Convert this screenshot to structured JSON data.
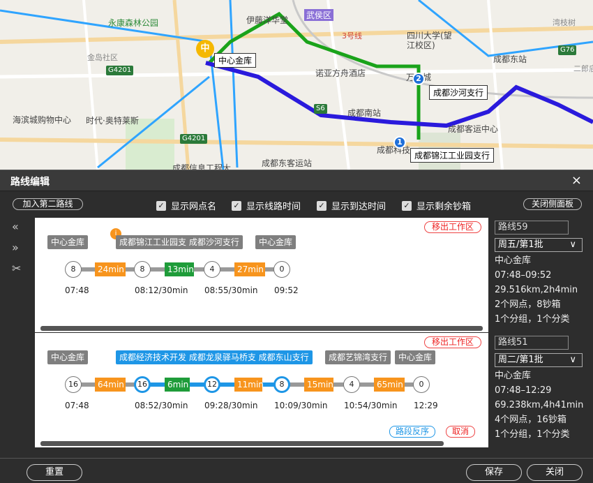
{
  "map": {
    "labels": {
      "yongkang": "永康森林公园",
      "jindaocun": "金岛社区",
      "yiteng": "伊藤洋华堂",
      "wuhou": "武侯区",
      "line3": "3号线",
      "sichuan": "四川大学(望江校区)",
      "wanxiang": "万象城",
      "nuoya": "诺亚方舟酒店",
      "haibin": "海滨城购物中心",
      "aotelai": "时代·奥特莱斯",
      "chengdunan": "成都南站",
      "chengdudong": "成都东站",
      "wanjiang": "湾枝树",
      "erlangmiao": "二郎庙",
      "chengduke": "成都客运中心",
      "chengdujiao": "成都东客运站",
      "chengduxinxi": "成都信息工程大",
      "chengdukeji": "成都科技"
    },
    "highways": {
      "g4201a": "G4201",
      "g4201b": "G4201",
      "s6": "S6",
      "g76": "G76"
    },
    "hq_pin": "中",
    "callouts": {
      "hq": "中心金库",
      "shahe": "成都沙河支行",
      "jinjiang": "成都锦江工业园支行"
    },
    "pins": {
      "p1": "1",
      "p2": "2"
    },
    "colors": {
      "blue_route": "#2a1adc",
      "green_route": "#1aa31a",
      "light_route": "#2fa4ff"
    }
  },
  "panel": {
    "title": "路线编辑",
    "close_icon": "×",
    "add_second_route": "加入第二路线",
    "close_side_panel": "关闭侧面板",
    "checkboxes": [
      {
        "label": "显示网点名",
        "checked": true
      },
      {
        "label": "显示线路时间",
        "checked": true
      },
      {
        "label": "显示到达时间",
        "checked": true
      },
      {
        "label": "显示剩余钞箱",
        "checked": true
      }
    ],
    "reset": "重置",
    "save": "保存",
    "close": "关闭"
  },
  "route1": {
    "move_out": "移出工作区",
    "tags": [
      {
        "text": "中心金库",
        "color": "gray"
      },
      {
        "text": "成都锦江工业园支 成都沙河支行",
        "color": "gray"
      },
      {
        "text": "中心金库",
        "color": "gray"
      }
    ],
    "badge": "i",
    "nodes": [
      "8",
      "8",
      "4",
      "0"
    ],
    "segments": [
      {
        "text": "24min",
        "color": "orange"
      },
      {
        "text": "13min",
        "color": "green"
      },
      {
        "text": "27min",
        "color": "orange"
      }
    ],
    "times": [
      "07:48",
      "08:12/30min",
      "08:55/30min",
      "09:52"
    ],
    "info": {
      "name": "路线59",
      "schedule": "周五/第1批",
      "origin": "中心金库",
      "window": "07:48–09:52",
      "distance": "29.516km,2h4min",
      "points": "2个网点，8钞箱",
      "groups": "1个分组，1个分类"
    }
  },
  "route2": {
    "move_out": "移出工作区",
    "tags": [
      {
        "text": "中心金库",
        "color": "gray"
      },
      {
        "text": "成都经济技术开发 成都龙泉驿马桥支 成都东山支行",
        "color": "blue"
      },
      {
        "text": "成都艺锦湾支行",
        "color": "gray"
      },
      {
        "text": "中心金库",
        "color": "gray"
      }
    ],
    "nodes": [
      "16",
      "16",
      "12",
      "8",
      "4",
      "0"
    ],
    "segments": [
      {
        "text": "64min",
        "color": "orange"
      },
      {
        "text": "6min",
        "color": "green"
      },
      {
        "text": "11min",
        "color": "orange"
      },
      {
        "text": "15min",
        "color": "orange"
      },
      {
        "text": "65min",
        "color": "orange"
      }
    ],
    "times": [
      "07:48",
      "08:52/30min",
      "09:28/30min",
      "10:09/30min",
      "10:54/30min",
      "12:29"
    ],
    "reverse": "路段反序",
    "cancel": "取消",
    "info": {
      "name": "路线51",
      "schedule": "周二/第1批",
      "origin": "中心金库",
      "window": "07:48–12:29",
      "distance": "69.238km,4h41min",
      "points": "4个网点，16钞箱",
      "groups": "1个分组，1个分类"
    }
  }
}
